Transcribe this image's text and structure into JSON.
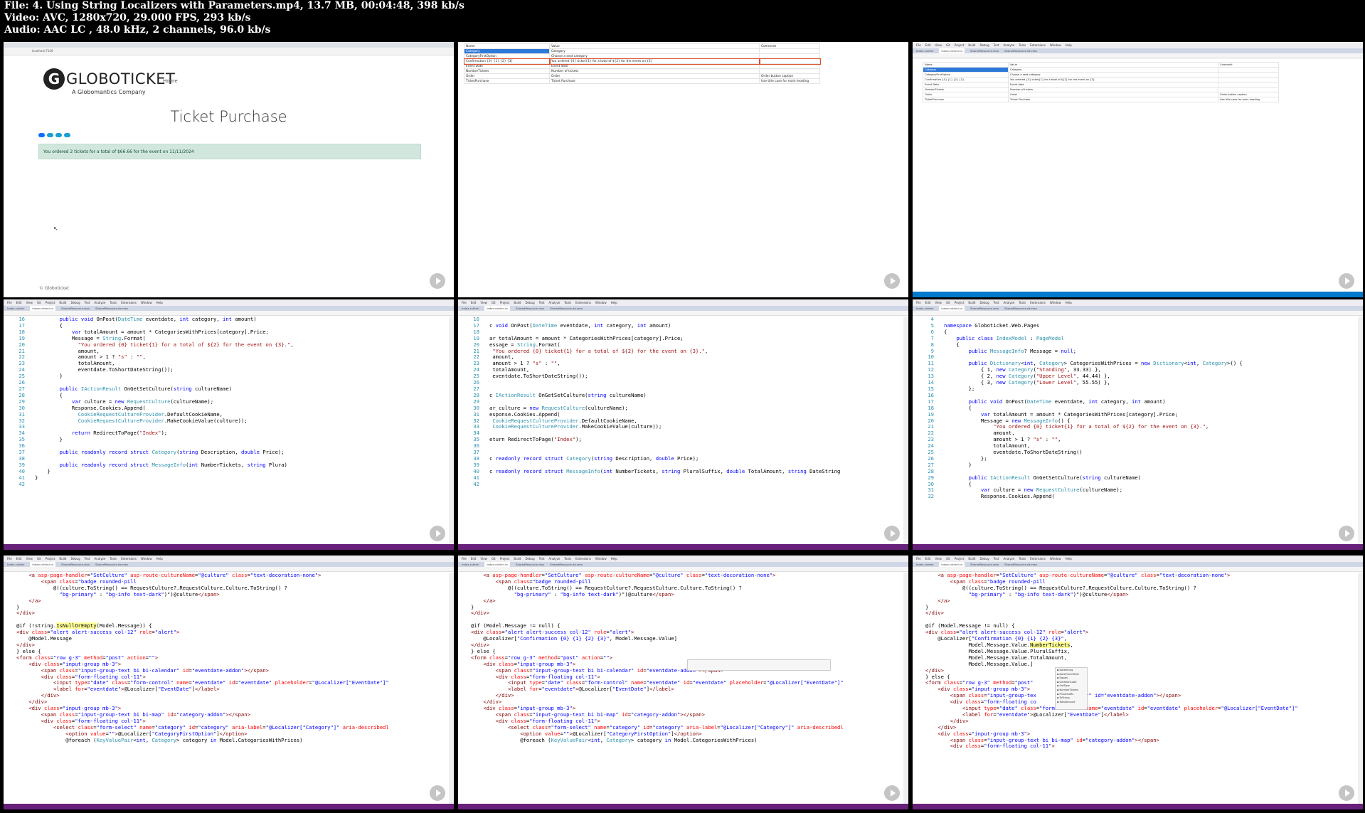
{
  "header": {
    "file_line": "File: 4. Using String Localizers with Parameters.mp4, 13.7 MB, 00:04:48, 398 kb/s",
    "video_line": "Video: AVC, 1280x720, 29.000 FPS, 293 kb/s",
    "audio_line": "Audio: AAC LC , 48.0 kHz, 2 channels, 96.0 kb/s"
  },
  "browser": {
    "address": "localhost:7140",
    "logo_text": "GLOBOTICKET",
    "subtitle": "A Globomantics Company",
    "nav_home": "Home",
    "page_title": "Ticket Purchase",
    "alert": "You ordered 2 tickets for a total of $66.66 for the event on 11/11/2024",
    "footer": "© Globoticket"
  },
  "resx": {
    "rows": [
      {
        "name": "Name",
        "value": "Value",
        "comment": "Comment"
      },
      {
        "name": "Category",
        "value": "Category",
        "comment": ""
      },
      {
        "name": "CategoryFirstOption",
        "value": "Choose a seat category",
        "comment": ""
      },
      {
        "name": "Confirmation {0} {1} {2} {3}",
        "value": "You ordered {0} ticket{1} for a total of ${2} for the event on {3}",
        "comment": ""
      },
      {
        "name": "Event Date",
        "value": "Event date",
        "comment": ""
      },
      {
        "name": "NumberTickets",
        "value": "Number of tickets",
        "comment": ""
      },
      {
        "name": "Order",
        "value": "Order",
        "comment": "Order button caption"
      },
      {
        "name": "TicketPurchase",
        "value": "Ticket Purchase",
        "comment": "Use title case for main heading"
      }
    ]
  },
  "vs": {
    "menu": [
      "File",
      "Edit",
      "View",
      "Git",
      "Project",
      "Build",
      "Debug",
      "Test",
      "Analyze",
      "Tools",
      "Extensions",
      "Window",
      "Help"
    ],
    "tabs": [
      "Index.cshtml",
      "Index.cshtml.cs",
      "SharedResource.resx",
      "SharedResource.de.resx"
    ]
  },
  "code1": [
    {
      "n": "16",
      "c": "        <k>public void</k> OnPost(<t>DateTime</t> eventdate, <k>int</k> category, <k>int</k> amount)"
    },
    {
      "n": "17",
      "c": "        {"
    },
    {
      "n": "18",
      "c": "            <k>var</k> totalAmount = amount * CategoriesWithPrices[category].Price;"
    },
    {
      "n": "19",
      "c": "            Message = <t>String</t>.Format("
    },
    {
      "n": "20",
      "c": "              <s>\"You ordered {0} ticket{1} for a total of ${2} for the event on {3}.\"</s>,"
    },
    {
      "n": "21",
      "c": "              amount,"
    },
    {
      "n": "22",
      "c": "              amount > 1 ? <s>\"s\"</s> : <s>\"\"</s>,"
    },
    {
      "n": "23",
      "c": "              totalAmount,"
    },
    {
      "n": "24",
      "c": "              eventdate.ToShortDateString());"
    },
    {
      "n": "25",
      "c": "        }"
    },
    {
      "n": "26",
      "c": ""
    },
    {
      "n": "27",
      "c": "        <k>public</k> <t>IActionResult</t> OnGetSetCulture(<k>string</k> cultureName)"
    },
    {
      "n": "28",
      "c": "        {"
    },
    {
      "n": "29",
      "c": "            <k>var</k> culture = <k>new</k> <t>RequestCulture</t>(cultureName);"
    },
    {
      "n": "30",
      "c": "            Response.Cookies.Append("
    },
    {
      "n": "31",
      "c": "              <t>CookieRequestCultureProvider</t>.DefaultCookieName,"
    },
    {
      "n": "32",
      "c": "              <t>CookieRequestCultureProvider</t>.MakeCookieValue(culture));"
    },
    {
      "n": "33",
      "c": ""
    },
    {
      "n": "34",
      "c": "            <k>return</k> RedirectToPage(<s>\"Index\"</s>);"
    },
    {
      "n": "35",
      "c": "        }"
    },
    {
      "n": "36",
      "c": ""
    },
    {
      "n": "37",
      "c": "        <k>public readonly record struct</k> <t>Category</t>(<k>string</k> Description, <k>double</k> Price);"
    },
    {
      "n": "38",
      "c": ""
    },
    {
      "n": "39",
      "c": "        <k>public readonly record struct</k> <t>MessageInfo</t>(<k>int</k> NumberTickets, <k>string</k> Plura)"
    },
    {
      "n": "40",
      "c": "    }"
    },
    {
      "n": "41",
      "c": "}"
    },
    {
      "n": "42",
      "c": ""
    }
  ],
  "code2": [
    {
      "n": "16",
      "c": ""
    },
    {
      "n": "17",
      "c": "c <k>void</k> OnPost(<t>DateTime</t> eventdate, <k>int</k> category, <k>int</k> amount)"
    },
    {
      "n": "18",
      "c": ""
    },
    {
      "n": "19",
      "c": "ar totalAmount = amount * CategoriesWithPrices[category].Price;"
    },
    {
      "n": "20",
      "c": "essage = <t>String</t>.Format("
    },
    {
      "n": "21",
      "c": " <s>\"You ordered {0} ticket{1} for a total of ${2} for the event on {3}.\"</s>,"
    },
    {
      "n": "22",
      "c": " amount,"
    },
    {
      "n": "23",
      "c": " amount > 1 ? <s>\"s\"</s> : <s>\"\"</s>,"
    },
    {
      "n": "24",
      "c": " totalAmount,"
    },
    {
      "n": "25",
      "c": " eventdate.ToShortDateString());"
    },
    {
      "n": "26",
      "c": ""
    },
    {
      "n": "27",
      "c": ""
    },
    {
      "n": "28",
      "c": "c <t>IActionResult</t> OnGetSetCulture(<k>string</k> cultureName)"
    },
    {
      "n": "29",
      "c": ""
    },
    {
      "n": "30",
      "c": "ar culture = <k>new</k> <t>RequestCulture</t>(cultureName);"
    },
    {
      "n": "31",
      "c": "esponse.Cookies.Append("
    },
    {
      "n": "32",
      "c": " <t>CookieRequestCultureProvider</t>.DefaultCookieName,"
    },
    {
      "n": "33",
      "c": " <t>CookieRequestCultureProvider</t>.MakeCookieValue(culture));"
    },
    {
      "n": "34",
      "c": ""
    },
    {
      "n": "35",
      "c": "eturn RedirectToPage(<s>\"Index\"</s>);"
    },
    {
      "n": "36",
      "c": ""
    },
    {
      "n": "37",
      "c": ""
    },
    {
      "n": "38",
      "c": "c <k>readonly record struct</k> <t>Category</t>(<k>string</k> Description, <k>double</k> Price);"
    },
    {
      "n": "39",
      "c": ""
    },
    {
      "n": "40",
      "c": "c <k>readonly record struct</k> <t>MessageInfo</t>(<k>int</k> NumberTickets, <k>string</k> PluralSuffix, <k>double</k> TotalAmount, <k>string</k> DateString"
    },
    {
      "n": "41",
      "c": ""
    },
    {
      "n": "42",
      "c": ""
    }
  ],
  "code3": [
    {
      "n": "4",
      "c": ""
    },
    {
      "n": "5",
      "c": "<k>namespace</k> Globoticket.Web.Pages"
    },
    {
      "n": "6",
      "c": "{"
    },
    {
      "n": "7",
      "c": "    <k>public class</k> <t>IndexModel</t> : <t>PageModel</t>"
    },
    {
      "n": "8",
      "c": "    {"
    },
    {
      "n": "9",
      "c": "        <k>public</k> <t>MessageInfo</t>? Message = <k>null</k>;"
    },
    {
      "n": "10",
      "c": ""
    },
    {
      "n": "11",
      "c": "        <k>public</k> <t>Dictionary</t>&lt;<k>int</k>, <t>Category</t>&gt; CategoriesWithPrices = <k>new</k> <t>Dictionary</t>&lt;<k>int</k>, <t>Category</t>&gt;() {"
    },
    {
      "n": "12",
      "c": "            { 1, <k>new</k> <t>Category</t>(<s>\"Standing\"</s>, 33.33) },"
    },
    {
      "n": "13",
      "c": "            { 2, <k>new</k> <t>Category</t>(<s>\"Upper Level\"</s>, 44.44) },"
    },
    {
      "n": "14",
      "c": "            { 3, <k>new</k> <t>Category</t>(<s>\"Lower Level\"</s>, 55.55) },"
    },
    {
      "n": "15",
      "c": "        };"
    },
    {
      "n": "16",
      "c": ""
    },
    {
      "n": "17",
      "c": "        <k>public void</k> OnPost(<t>DateTime</t> eventdate, <k>int</k> category, <k>int</k> amount)"
    },
    {
      "n": "18",
      "c": "        {"
    },
    {
      "n": "19",
      "c": "            <k>var</k> totalAmount = amount * CategoriesWithPrices[category].Price;"
    },
    {
      "n": "20",
      "c": "            Message = <k>new</k> <t>MessageInfo</t>() {"
    },
    {
      "n": "21",
      "c": "                <s>\"You ordered {0} ticket{1} for a total of ${2} for the event on {3}.\"</s>,"
    },
    {
      "n": "22",
      "c": "                amount,"
    },
    {
      "n": "23",
      "c": "                amount > 1 ? <s>\"s\"</s> : <s>\"\"</s>,"
    },
    {
      "n": "24",
      "c": "                totalAmount,"
    },
    {
      "n": "25",
      "c": "                eventdate.ToShortDateString()"
    },
    {
      "n": "26",
      "c": "            };"
    },
    {
      "n": "27",
      "c": "        }"
    },
    {
      "n": "28",
      "c": ""
    },
    {
      "n": "29",
      "c": "        <k>public</k> <t>IActionResult</t> OnGetSetCulture(<k>string</k> cultureName)"
    },
    {
      "n": "30",
      "c": "        {"
    },
    {
      "n": "31",
      "c": "            <k>var</k> culture = <k>new</k> <t>RequestCulture</t>(cultureName);"
    },
    {
      "n": "32",
      "c": "            Response.Cookies.Append("
    }
  ],
  "razor1": [
    "    <g>&lt;a</g> <a>asp-page-handler</a>=<v>\"SetCulture\"</v> <a>asp-route-cultureName</a>=<v>\"@culture\"</v> <a>class</a>=<v>\"text-decoration-none\"</v><g>&gt;</g>",
    "        <g>&lt;span</g> <a>class</a>=<v>\"badge rounded-pill</v>",
    "            @((culture.ToString() == RequestCulture?.RequestCulture.Culture.ToString() ?",
    "              <v>\"bg-primary\"</v> : <v>\"bg-info text-dark\"</v>)\")@culture<g>&lt;/span&gt;</g>",
    "    <g>&lt;/a&gt;</g>",
    "}",
    "<g>&lt;/div&gt;</g>",
    "",
    "@if (!string.<r>IsNullOrEmpty</r>(Model.Message)) {",
    "<g>&lt;div</g> <a>class</a>=<v>\"alert alert-success col-12\"</v> <a>role</a>=<v>\"alert\"</v><g>&gt;</g>",
    "    @Model.Message",
    "<g>&lt;/div&gt;</g>",
    "} else {",
    "<g>&lt;form</g> <a>class</a>=<v>\"row g-3\"</v> <a>method</a>=<v>\"post\"</v> <a>action</a>=<v>\"\"</v><g>&gt;</g>",
    "    <g>&lt;div</g> <a>class</a>=<v>\"input-group mb-3\"</v><g>&gt;</g>",
    "        <g>&lt;span</g> <a>class</a>=<v>\"input-group-text bi bi-calendar\"</v> <a>id</a>=<v>\"eventdate-addon\"</v><g>&gt;&lt;/span&gt;</g>",
    "        <g>&lt;div</g> <a>class</a>=<v>\"form-floating col-11\"</v><g>&gt;</g>",
    "            <g>&lt;input</g> <a>type</a>=<v>\"date\"</v> <a>class</a>=<v>\"form-control\"</v> <a>name</a>=<v>\"eventdate\"</v> <a>id</a>=<v>\"eventdate\"</v> <a>placeholder</a>=<v>\"@Localizer[\"EventDate\"]\"</v>",
    "            <g>&lt;label</g> <a>for</a>=<v>\"eventdate\"</v><g>&gt;</g>@Localizer[<v>\"EventDate\"</v>]<g>&lt;/label&gt;</g>",
    "        <g>&lt;/div&gt;</g>",
    "    <g>&lt;/div&gt;</g>",
    "    <g>&lt;div</g> <a>class</a>=<v>\"input-group mb-3\"</v><g>&gt;</g>",
    "        <g>&lt;span</g> <a>class</a>=<v>\"input-group-text bi bi-map\"</v> <a>id</a>=<v>\"category-addon\"</v><g>&gt;&lt;/span&gt;</g>",
    "        <g>&lt;div</g> <a>class</a>=<v>\"form-floating col-11\"</v><g>&gt;</g>",
    "            <g>&lt;select</g> <a>class</a>=<v>\"form-select\"</v> <a>name</a>=<v>\"category\"</v> <a>id</a>=<v>\"category\"</v> <a>aria-label</a>=<v>\"@Localizer[\"Category\"]\"</v> <a>aria-describedl</a>",
    "                <g>&lt;option</g> <a>value</a>=<v>\"\"</v><g>&gt;</g>@Localizer[<v>\"CategoryFirstOption\"</v>]<g>&lt;/option&gt;</g>",
    "                @foreach (<t>KeyValuePair</t>&lt;<k>int</k>, <t>Category</t>&gt; category <k>in</k> Model.CategoriesWithPrices)"
  ],
  "razor2": [
    "    <g>&lt;a</g> <a>asp-page-handler</a>=<v>\"SetCulture\"</v> <a>asp-route-cultureName</a>=<v>\"@culture\"</v> <a>class</a>=<v>\"text-decoration-none\"</v><g>&gt;</g>",
    "        <g>&lt;span</g> <a>class</a>=<v>\"badge rounded-pill</v>",
    "            @((culture.ToString() == RequestCulture?.RequestCulture.Culture.ToString() ?",
    "              <v>\"bg-primary\"</v> : <v>\"bg-info text-dark\"</v>)\")@culture<g>&lt;/span&gt;</g>",
    "    <g>&lt;/a&gt;</g>",
    "}",
    "<g>&lt;/div&gt;</g>",
    "",
    "@if (Model.Message != null) {",
    "<g>&lt;div</g> <a>class</a>=<v>\"alert alert-success col-12\"</v> <a>role</a>=<v>\"alert\"</v><g>&gt;</g>",
    "    @Localizer[<v>\"Confirmation {0} {1} {2} {3}\"</v>, Model.Message.Value]",
    "<g>&lt;/div&gt;</g>",
    "} else {",
    "<g>&lt;form</g> <a>class</a>=<v>\"row g-3\"</v> <a>method</a>=<v>\"post\"</v> <a>action</a>=<v>\"\"</v><g>&gt;</g>",
    "    <g>&lt;div</g> <a>class</a>=<v>\"input-group mb-3\"</v><g>&gt;</g>",
    "        <g>&lt;span</g> <a>class</a>=<v>\"input-group-text bi bi-calendar\"</v> <a>id</a>=<v>\"eventdate-addon\"</v><g>&gt;&lt;/span&gt;</g>",
    "        <g>&lt;div</g> <a>class</a>=<v>\"form-floating col-11\"</v><g>&gt;</g>",
    "            <g>&lt;input</g> <a>type</a>=<v>\"date\"</v> <a>class</a>=<v>\"form-control\"</v> <a>name</a>=<v>\"eventdate\"</v> <a>id</a>=<v>\"eventdate\"</v> <a>placeholder</a>=<v>\"@Localizer[\"EventDate\"]\"</v>",
    "            <g>&lt;label</g> <a>for</a>=<v>\"eventdate\"</v><g>&gt;</g>@Localizer[<v>\"EventDate\"</v>]<g>&lt;/label&gt;</g>",
    "        <g>&lt;/div&gt;</g>",
    "    <g>&lt;/div&gt;</g>",
    "    <g>&lt;div</g> <a>class</a>=<v>\"input-group mb-3\"</v><g>&gt;</g>",
    "        <g>&lt;span</g> <a>class</a>=<v>\"input-group-text bi bi-map\"</v> <a>id</a>=<v>\"category-addon\"</v><g>&gt;&lt;/span&gt;</g>",
    "        <g>&lt;div</g> <a>class</a>=<v>\"form-floating col-11\"</v><g>&gt;</g>",
    "            <g>&lt;select</g> <a>class</a>=<v>\"form-select\"</v> <a>name</a>=<v>\"category\"</v> <a>id</a>=<v>\"category\"</v> <a>aria-label</a>=<v>\"@Localizer[\"Category\"]\"</v> <a>aria-describedl</a>",
    "                <g>&lt;option</g> <a>value</a>=<v>\"\"</v><g>&gt;</g>@Localizer[<v>\"CategoryFirstOption\"</v>]<g>&lt;/option&gt;</g>",
    "                @foreach (<t>KeyValuePair</t>&lt;<k>int</k>, <t>Category</t>&gt; category <k>in</k> Model.CategoriesWithPrices)"
  ],
  "razor3": [
    "    <g>&lt;a</g> <a>asp-page-handler</a>=<v>\"SetCulture\"</v> <a>asp-route-cultureName</a>=<v>\"@culture\"</v> <a>class</a>=<v>\"text-decoration-none\"</v><g>&gt;</g>",
    "        <g>&lt;span</g> <a>class</a>=<v>\"badge rounded-pill</v>",
    "            @((culture.ToString() == RequestCulture?.RequestCulture.Culture.ToString() ?",
    "              <v>\"bg-primary\"</v> : <v>\"bg-info text-dark\"</v>)\")@culture<g>&lt;/span&gt;</g>",
    "    <g>&lt;/a&gt;</g>",
    "}",
    "<g>&lt;/div&gt;</g>",
    "",
    "@if (Model.Message != null) {",
    "<g>&lt;div</g> <a>class</a>=<v>\"alert alert-success col-12\"</v> <a>role</a>=<v>\"alert\"</v><g>&gt;</g>",
    "    @Localizer[<v>\"Confirmation {0} {1} {2} {3}\"</v>,",
    "              Model.Message.Value.<r>NumberTickets</r>,",
    "              Model.Message.Value.PluralSuffix,",
    "              Model.Message.Value.TotalAmount,",
    "              Model.Message.Value.]",
    "<g>&lt;/div&gt;</g>",
    "} else {",
    "<g>&lt;form</g> <a>class</a>=<v>\"row g-3\"</v> <a>method</a>=<v>\"post\"</v>",
    "    <g>&lt;div</g> <a>class</a>=<v>\"input-group mb-3\"</v><g>&gt;</g>",
    "        <g>&lt;span</g> <a>class</a>=<v>\"input-group-tex</v>         <a>calendar</a><v>\" id=\"eventdate-addon\"</v><g>&gt;&lt;/span&gt;</g>",
    "        <g>&lt;div</g> <a>class</a>=<v>\"form-floating co</v>",
    "            <g>&lt;input</g> <a>type</a>=<v>\"date\"</v> <a>class</a>=<v>\"form-control\"</v> <a>name</a>=<v>\"eventdate\"</v> <a>id</a>=<v>\"eventdate\"</v> <a>placeholder</a>=<v>\"@Localizer[\"EventDate\"]\"</v>",
    "            <g>&lt;label</g> <a>for</a>=<v>\"eventdate\"</v><g>&gt;</g>@Localizer[<v>\"EventDate\"</v>]<g>&lt;/label&gt;</g>",
    "        <g>&lt;/div&gt;</g>",
    "    <g>&lt;/div&gt;</g>",
    "    <g>&lt;div</g> <a>class</a>=<v>\"input-group mb-3\"</v><g>&gt;</g>",
    "        <g>&lt;span</g> <a>class</a>=<v>\"input-group-text bi bi-map\"</v> <a>id</a>=<v>\"category-addon\"</v><g>&gt;&lt;/span&gt;</g>",
    "        <g>&lt;div</g> <a>class</a>=<v>\"form-floating col-11\"</v><g>&gt;</g>"
  ],
  "intellisense": [
    "DateString",
    "DateTimeOffset",
    "Equals",
    "GetHashCode",
    "GetType",
    "NumberTickets",
    "PluralSuffix",
    "ToString",
    "TotalAmount"
  ]
}
